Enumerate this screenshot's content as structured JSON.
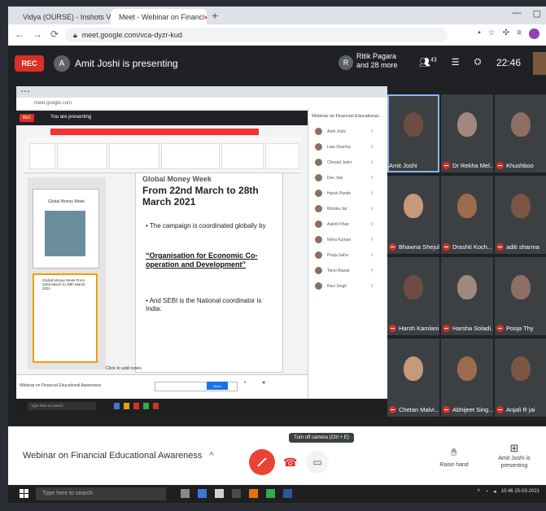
{
  "browser": {
    "tabs": [
      {
        "label": "Vidya (OURSE) - Inshots Vide"
      },
      {
        "label": "Meet - Webinar on Financi"
      }
    ],
    "url": "meet.google.com/vca-dyzr-kud"
  },
  "meet_header": {
    "rec_label": "REC",
    "presenter_initial": "A",
    "presenting_text": "Amit Joshi is presenting",
    "other_initial": "R",
    "others_text": "Ritik Pagara and 28 more",
    "participants_count": "43",
    "time": "22:46"
  },
  "shared_screen": {
    "presenting_text": "You are presenting",
    "rec_label": "REC",
    "side_title": "Webinar on Financial Educational...",
    "people": [
      "Amit Joshi",
      "Lata Sharma",
      "Chestal Joshi",
      "Dev Jain",
      "Harsh Pande",
      "Monika Jat",
      "Aakriti Khan",
      "Neha Kumari",
      "Pooja Sahu",
      "Tanvi Rawat",
      "Ravi Singh"
    ],
    "slide": {
      "heading_top": "Global Money Week",
      "date_line": "From 22nd March to 28th March 2021",
      "bullet1": "• The campaign is coordinated globally by",
      "bullet2_quote": "“Organisation for Economic Co-operation and Development”",
      "bullet3": "• And SEBI is the National coordinator is India.",
      "notes": "Click to add notes"
    },
    "thumb1_title": "Global Money Week",
    "thumb2_text": "Global Money Week From 22nd March to 28th March 2021",
    "bottom_title": "Webinar on Financial Educational Awareness",
    "bottom_btn": "Send",
    "taskbar_search": "Type here to search"
  },
  "tiles": [
    {
      "name": "Amit Joshi"
    },
    {
      "name": "Dr Rekha Mel..."
    },
    {
      "name": "Khushboo"
    },
    {
      "name": "Bhawna Shejul"
    },
    {
      "name": "Drashti Koch..."
    },
    {
      "name": "aditi sharma"
    },
    {
      "name": "Harsh Kamlani"
    },
    {
      "name": "Harsha Soladi..."
    },
    {
      "name": "Pooja Thy"
    },
    {
      "name": "Chetan Malvi..."
    },
    {
      "name": "Abhijeet Sing..."
    },
    {
      "name": "Anjali R jai"
    }
  ],
  "bottom_bar": {
    "meeting_name": "Webinar on Financial Educational Awareness",
    "tooltip": "Turn off camera (Ctrl + E)",
    "raise_hand": "Raise hand",
    "presenting_label": "Amit Joshi is presenting"
  },
  "taskbar": {
    "search_placeholder": "Type here to search",
    "clock": "10:46 25-03-2021"
  }
}
